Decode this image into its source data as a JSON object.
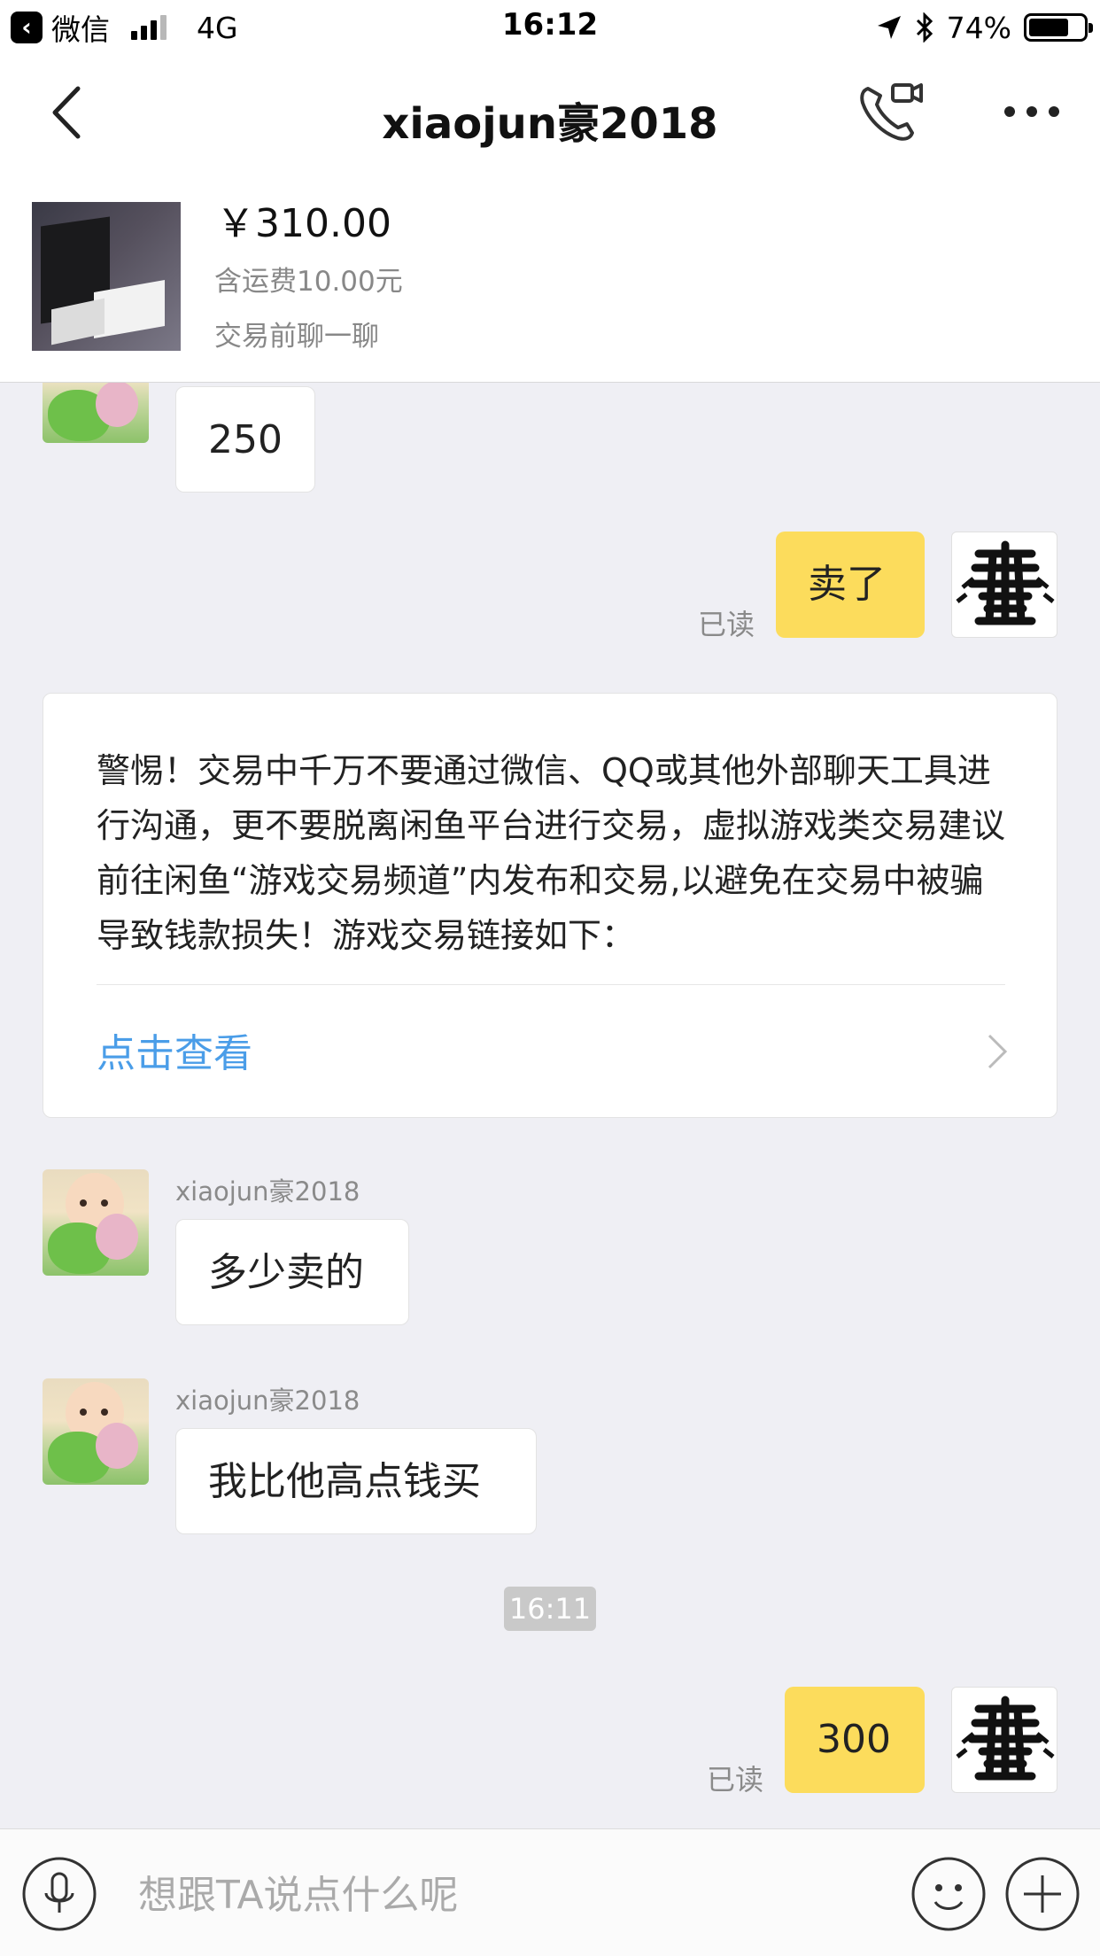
{
  "status_bar": {
    "back_app_label": "微信",
    "network": "4G",
    "time": "16:12",
    "battery_percent": "74%",
    "battery_level": 0.74
  },
  "nav": {
    "title": "xiaojun豪2018",
    "icons": [
      "back-arrow-icon",
      "video-call-icon",
      "more-dots-icon"
    ]
  },
  "item": {
    "price": "￥310.00",
    "shipping": "含运费10.00元",
    "subtitle": "交易前聊一聊"
  },
  "messages": {
    "m1": {
      "text": "250"
    },
    "m2": {
      "text": "卖了",
      "read_label": "已读"
    },
    "notice": {
      "text": "警惕！交易中千万不要通过微信、QQ或其他外部聊天工具进行沟通，更不要脱离闲鱼平台进行交易，虚拟游戏类交易建议前往闲鱼“游戏交易频道”内发布和交易,以避免在交易中被骗导致钱款损失！游戏交易链接如下：",
      "link_label": "点击查看"
    },
    "m3": {
      "sender": "xiaojun豪2018",
      "text": "多少卖的"
    },
    "m4": {
      "sender": "xiaojun豪2018",
      "text": "我比他高点钱买"
    },
    "timestamp": "16:11",
    "m5": {
      "text": "300",
      "read_label": "已读"
    }
  },
  "input_bar": {
    "placeholder": "想跟TA说点什么呢"
  },
  "colors": {
    "accent_bubble": "#fcdc5c",
    "link": "#4a9de8",
    "background": "#efeff4"
  }
}
